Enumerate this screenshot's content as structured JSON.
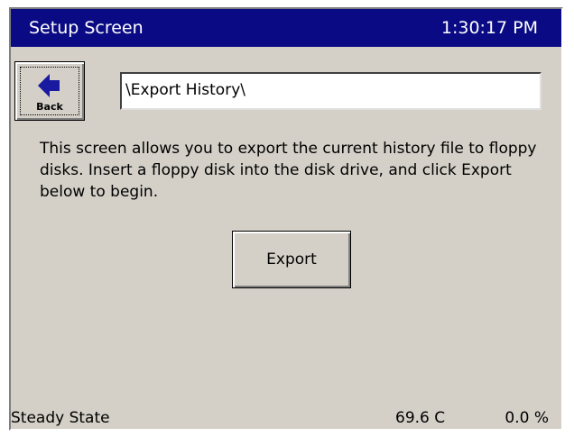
{
  "header": {
    "title": "Setup Screen",
    "time": "1:30:17 PM"
  },
  "back_button": {
    "label": "Back",
    "icon": "arrow-left-icon"
  },
  "path_field": {
    "value": "\\Export History\\"
  },
  "description": "This screen allows you to export the current history file to floppy disks.  Insert a floppy disk into the disk drive, and click Export below to begin.",
  "export_button": {
    "label": "Export"
  },
  "status_bar": {
    "state": "Steady State",
    "temperature": "69.6 C",
    "percent": "0.0 %"
  },
  "colors": {
    "titlebar": "#0a0a84",
    "panel": "#d4d0c8"
  }
}
